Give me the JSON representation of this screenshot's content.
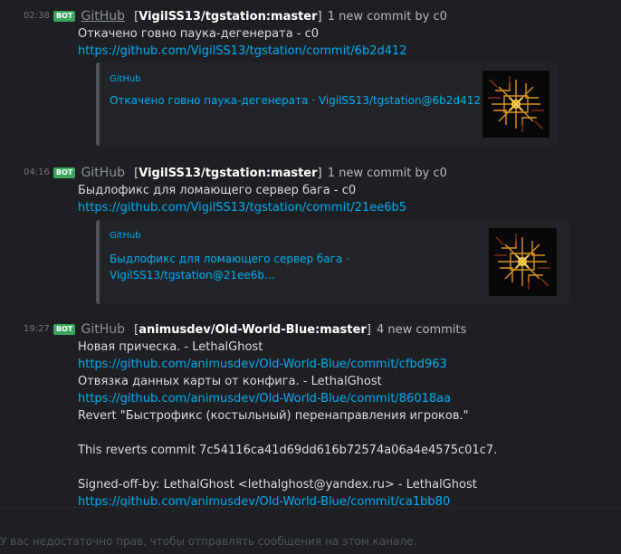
{
  "messages": [
    {
      "time": "02:38",
      "bot_tag": "BOT",
      "author": "GitHub",
      "repo": "VigilSS13/tgstation:master",
      "summary": "1 new commit by c0",
      "lines": [
        {
          "text": "Откачено говно паука-дегенерата - c0",
          "type": "text"
        },
        {
          "text": "https://github.com/VigilSS13/tgstation/commit/6b2d412",
          "type": "link"
        }
      ],
      "embed": {
        "provider": "GitHub",
        "title": "Откачено говно паука-дегенерата · VigilSS13/tgstation@6b2d412"
      }
    },
    {
      "time": "04:16",
      "bot_tag": "BOT",
      "author": "GitHub",
      "repo": "VigilSS13/tgstation:master",
      "summary": "1 new commit by c0",
      "lines": [
        {
          "text": "Быдлофикс для ломающего сервер бага - c0",
          "type": "text"
        },
        {
          "text": "https://github.com/VigilSS13/tgstation/commit/21ee6b5",
          "type": "link"
        }
      ],
      "embed": {
        "provider": "GitHub",
        "title_line1": "Быдлофикс для ломающего сервер бага ·",
        "title_line2": "VigilSS13/tgstation@21ee6b..."
      }
    },
    {
      "time": "19:27",
      "bot_tag": "BOT",
      "author": "GitHub",
      "repo": "animusdev/Old-World-Blue:master",
      "summary": "4 new commits",
      "lines": [
        {
          "text": "Новая прическа. - LethalGhost",
          "type": "text"
        },
        {
          "text": "https://github.com/animusdev/Old-World-Blue/commit/cfbd963",
          "type": "link"
        },
        {
          "text": "Отвязка данных карты от конфига. - LethalGhost",
          "type": "text"
        },
        {
          "text": "https://github.com/animusdev/Old-World-Blue/commit/86018aa",
          "type": "link"
        },
        {
          "text": "Revert \"Быстрофикс (костыльный) перенаправления игроков.\"",
          "type": "text"
        },
        {
          "text": "This reverts commit 7c54116ca41d69dd616b72574a06a4e4575c01c7.",
          "type": "text"
        },
        {
          "text": "Signed-off-by: LethalGhost <lethalghost@yandex.ru> - LethalGhost",
          "type": "text"
        },
        {
          "text": "https://github.com/animusdev/Old-World-Blue/commit/ca1bb80",
          "type": "link"
        }
      ]
    }
  ],
  "input": {
    "notice": "У вас недостаточно прав, чтобы отправлять сообщения на этом канале."
  },
  "colors": {
    "background": "#1e1f22",
    "link": "#00aff4",
    "bot_badge": "#3ba55d",
    "embed_background": "#222326",
    "embed_border": "#4f545c"
  },
  "icons": [
    "github-thumbnail-icon"
  ]
}
